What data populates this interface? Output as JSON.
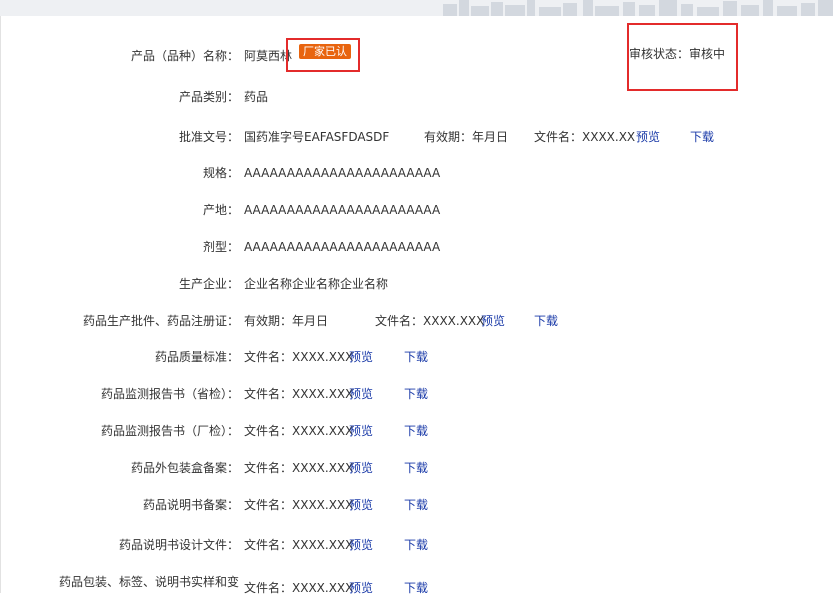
{
  "product_name": {
    "label": "产品（品种）名称：",
    "value": "阿莫西林",
    "badge": "厂家已认"
  },
  "audit_status": {
    "label": "审核状态：",
    "value": "审核中"
  },
  "category": {
    "label": "产品类别：",
    "value": "药品"
  },
  "approval": {
    "label": "批准文号：",
    "value": "国药准字号EAFASFDASDF",
    "validity": "有效期：年月日",
    "file": "文件名：XXXX.XX",
    "preview": "预览",
    "download": "下载"
  },
  "spec": {
    "label": "规格：",
    "value": "AAAAAAAAAAAAAAAAAAAAAAA"
  },
  "origin": {
    "label": "产地：",
    "value": "AAAAAAAAAAAAAAAAAAAAAAA"
  },
  "dosage_form": {
    "label": "剂型：",
    "value": "AAAAAAAAAAAAAAAAAAAAAAA"
  },
  "manufacturer": {
    "label": "生产企业：",
    "value": "企业名称企业名称企业名称"
  },
  "production_license": {
    "label": "药品生产批件、药品注册证：",
    "validity": "有效期：年月日",
    "file": "文件名：XXXX.XXX",
    "preview": "预览",
    "download": "下载"
  },
  "documents": [
    {
      "label": "药品质量标准：",
      "file": "文件名：XXXX.XXX",
      "preview": "预览",
      "download": "下载"
    },
    {
      "label": "药品监测报告书（省检）：",
      "file": "文件名：XXXX.XXX",
      "preview": "预览",
      "download": "下载"
    },
    {
      "label": "药品监测报告书（厂检）：",
      "file": "文件名：XXXX.XXX",
      "preview": "预览",
      "download": "下载"
    },
    {
      "label": "药品外包装盒备案：",
      "file": "文件名：XXXX.XXX",
      "preview": "预览",
      "download": "下载"
    },
    {
      "label": "药品说明书备案：",
      "file": "文件名：XXXX.XXX",
      "preview": "预览",
      "download": "下载"
    },
    {
      "label": "药品说明书设计文件：",
      "file": "文件名：XXXX.XXX",
      "preview": "预览",
      "download": "下载"
    },
    {
      "label": "药品包装、标签、说明书实样和变",
      "file": "文件名：XXXX.XXX",
      "preview": "预览",
      "download": "下载"
    }
  ],
  "colors": {
    "link": "#1a3aa8",
    "badge": "#e8640e",
    "highlight_box": "#e32b2b"
  }
}
